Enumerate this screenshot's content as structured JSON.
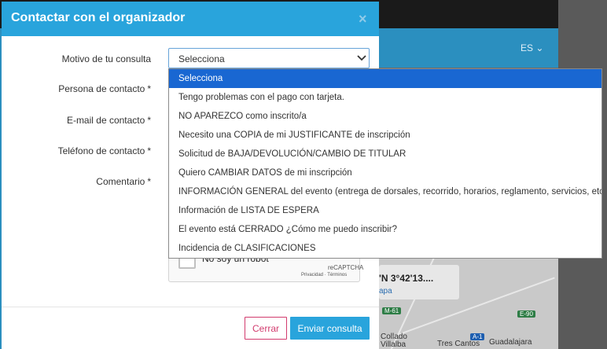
{
  "background": {
    "language": "ES ⌄",
    "coordinates": "'N 3°42'13....",
    "map_link": "apa",
    "cities": [
      "Collado Villalba",
      "Tres Cantos",
      "Guadalajara"
    ],
    "road_badges": [
      "E-90",
      "A-1",
      "M-61"
    ]
  },
  "modal": {
    "title": "Contactar con el organizador",
    "close_symbol": "×",
    "fields": {
      "motivo_label": "Motivo de tu consulta",
      "persona_label": "Persona de contacto",
      "email_label": "E-mail de contacto",
      "telefono_label": "Teléfono de contacto",
      "comentario_label": "Comentario",
      "required_mark": "*"
    },
    "select": {
      "value": "Selecciona",
      "options": [
        "Selecciona",
        "Tengo problemas con el pago con tarjeta.",
        "NO APAREZCO como inscrito/a",
        "Necesito una COPIA de mi JUSTIFICANTE de inscripción",
        "Solicitud de BAJA/DEVOLUCIÓN/CAMBIO DE TITULAR",
        "Quiero CAMBIAR DATOS de mi inscripción",
        "INFORMACIÓN GENERAL del evento (entrega de dorsales, recorrido, horarios, reglamento, servicios, etc.)",
        "Información de LISTA DE ESPERA",
        "El evento está CERRADO ¿Cómo me puedo inscribir?",
        "Incidencia de CLASIFICACIONES"
      ],
      "selected_index": 0
    },
    "captcha": {
      "text": "No soy un robot",
      "brand": "reCAPTCHA",
      "links": "Privacidad · Términos"
    },
    "buttons": {
      "cancel": "Cerrar",
      "send": "Enviar consulta"
    }
  },
  "colors": {
    "header": "#29a4dc",
    "cancel": "#d23b6e",
    "send": "#29a4dc",
    "selected_option": "#1967d2"
  },
  "icons": {
    "close": "close-icon",
    "select_chevron": "chevron-down-icon"
  }
}
